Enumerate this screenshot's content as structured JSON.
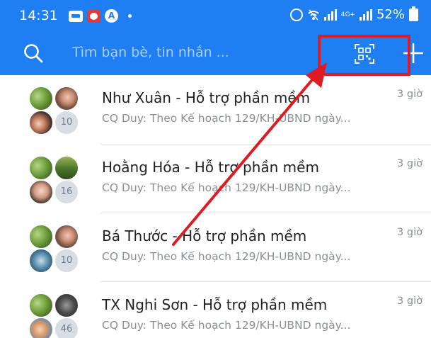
{
  "status_bar": {
    "time": "14:31",
    "battery_percent": "52%",
    "network_label": "4G+",
    "icons": [
      "zalo-icon",
      "notification-icon",
      "a-icon",
      "alarm-icon",
      "mute-wifi-icon",
      "signal-icon",
      "battery-icon"
    ]
  },
  "search": {
    "placeholder": "Tìm bạn bè, tin nhắn ...",
    "icons": [
      "search-icon",
      "qr-code-icon",
      "plus-icon"
    ]
  },
  "conversations": [
    {
      "title": "Như Xuân - Hỗ trợ phần mềm",
      "preview": "CQ Duy: Theo Kế hoạch 129/KH-UBND ngày...",
      "time": "3 giờ",
      "member_count": "10"
    },
    {
      "title": "Hoằng Hóa - Hỗ trợ phần mềm",
      "preview": "CQ Duy: Theo Kế hoạch 129/KH-UBND ngày...",
      "time": "3 giờ",
      "member_count": "16"
    },
    {
      "title": "Bá Thước - Hỗ trợ phần mềm",
      "preview": "CQ Duy: Theo Kế hoạch 129/KH-UBND ngày...",
      "time": "3 giờ",
      "member_count": "10"
    },
    {
      "title": "TX Nghi Sơn - Hỗ trợ phần mềm",
      "preview": "CQ Duy: Theo Kế hoạch 129/KH-UBND ngày...",
      "time": "3 giờ",
      "member_count": "46"
    }
  ],
  "colors": {
    "header_blue": "#1f7ff2",
    "highlight_red": "#e01a22",
    "title_text": "#222222",
    "secondary_text": "#8a8f96"
  }
}
